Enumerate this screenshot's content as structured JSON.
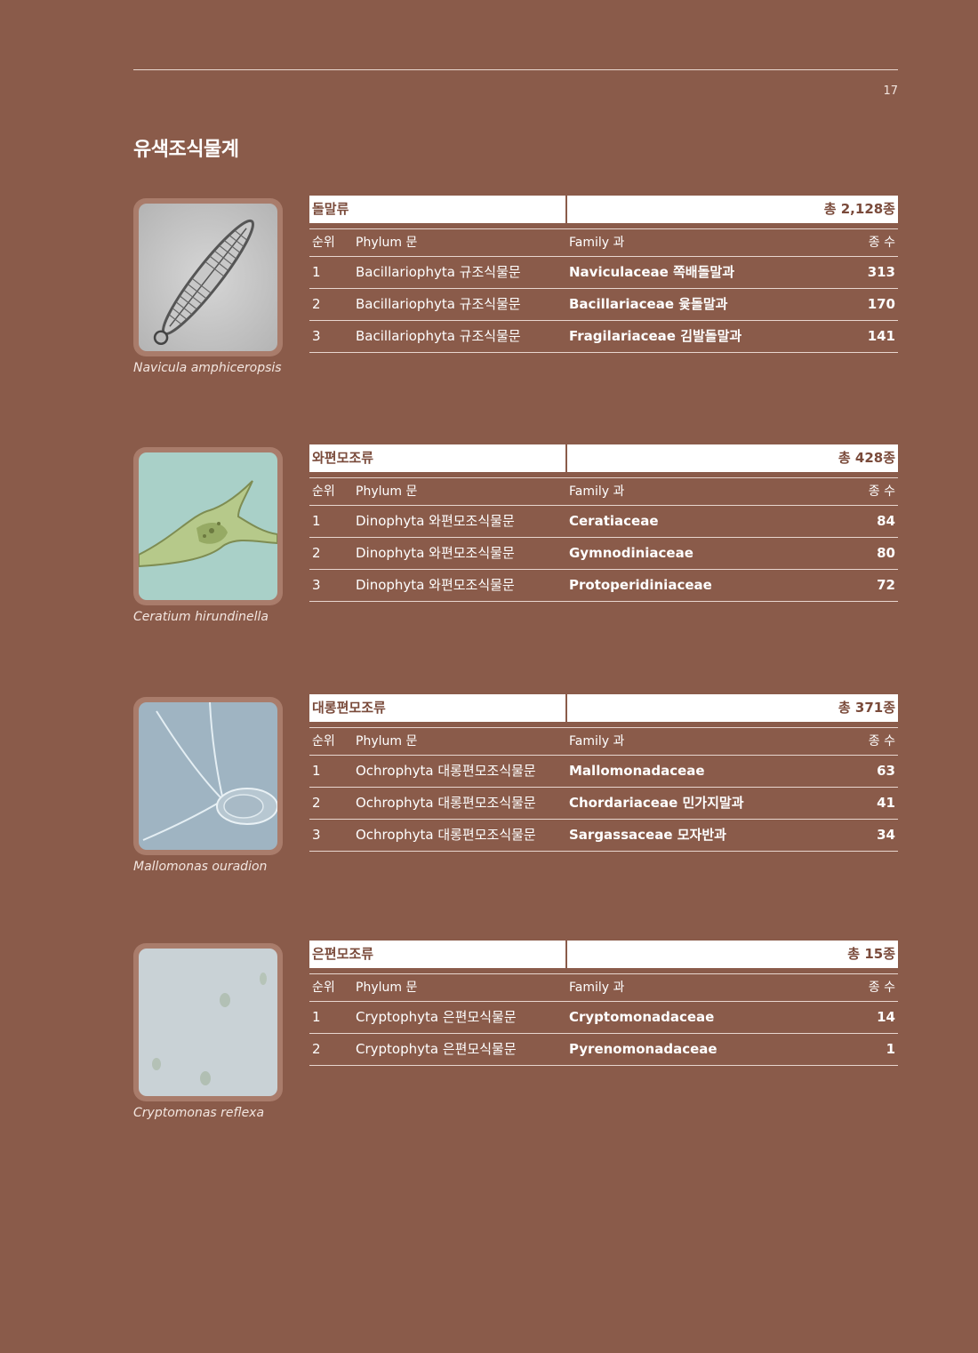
{
  "page": {
    "number": "17",
    "title": "유색조식물계"
  },
  "columns": {
    "rank": "순위",
    "phylum": "Phylum 문",
    "family": "Family 과",
    "count": "종 수"
  },
  "groups": [
    {
      "name": "돌말류",
      "total": "총 2,128종",
      "caption": "Navicula amphiceropsis",
      "rows": [
        {
          "rank": "1",
          "phylum": "Bacillariophyta 규조식물문",
          "family": "Naviculaceae 쪽배돌말과",
          "count": "313"
        },
        {
          "rank": "2",
          "phylum": "Bacillariophyta 규조식물문",
          "family": "Bacillariaceae 윷돌말과",
          "count": "170"
        },
        {
          "rank": "3",
          "phylum": "Bacillariophyta 규조식물문",
          "family": "Fragilariaceae 김발돌말과",
          "count": "141"
        }
      ]
    },
    {
      "name": "와편모조류",
      "total": "총 428종",
      "caption": "Ceratium hirundinella",
      "rows": [
        {
          "rank": "1",
          "phylum": "Dinophyta 와편모조식물문",
          "family": "Ceratiaceae",
          "count": "84"
        },
        {
          "rank": "2",
          "phylum": "Dinophyta 와편모조식물문",
          "family": "Gymnodiniaceae",
          "count": "80"
        },
        {
          "rank": "3",
          "phylum": "Dinophyta 와편모조식물문",
          "family": "Protoperidiniaceae",
          "count": "72"
        }
      ]
    },
    {
      "name": "대롱편모조류",
      "total": "총 371종",
      "caption": "Mallomonas ouradion",
      "rows": [
        {
          "rank": "1",
          "phylum": "Ochrophyta 대롱편모조식물문",
          "family": "Mallomonadaceae",
          "count": "63"
        },
        {
          "rank": "2",
          "phylum": "Ochrophyta 대롱편모조식물문",
          "family": "Chordariaceae 민가지말과",
          "count": "41"
        },
        {
          "rank": "3",
          "phylum": "Ochrophyta 대롱편모조식물문",
          "family": "Sargassaceae 모자반과",
          "count": "34"
        }
      ]
    },
    {
      "name": "은편모조류",
      "total": "총 15종",
      "caption": "Cryptomonas reflexa",
      "rows": [
        {
          "rank": "1",
          "phylum": "Cryptophyta 은편모식물문",
          "family": "Cryptomonadaceae",
          "count": "14"
        },
        {
          "rank": "2",
          "phylum": "Cryptophyta 은편모식물문",
          "family": "Pyrenomonadaceae",
          "count": "1"
        }
      ]
    }
  ]
}
